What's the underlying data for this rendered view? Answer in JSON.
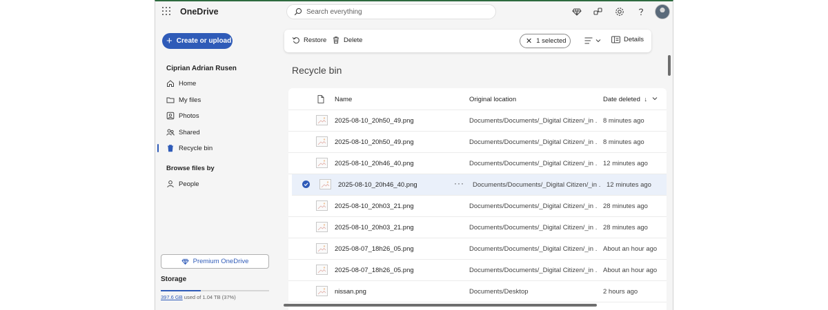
{
  "header": {
    "app_name": "OneDrive",
    "search_placeholder": "Search everything"
  },
  "sidebar": {
    "create_label": "Create or upload",
    "user_name": "Ciprian Adrian Rusen",
    "items": [
      {
        "label": "Home",
        "icon": "home-icon"
      },
      {
        "label": "My files",
        "icon": "folder-icon"
      },
      {
        "label": "Photos",
        "icon": "photos-icon"
      },
      {
        "label": "Shared",
        "icon": "shared-icon"
      },
      {
        "label": "Recycle bin",
        "icon": "recycle-bin-icon",
        "active": true
      }
    ],
    "browse_label": "Browse files by",
    "browse_items": [
      {
        "label": "People",
        "icon": "person-icon"
      }
    ],
    "premium_label": "Premium OneDrive",
    "storage_title": "Storage",
    "storage_used": "397.6 GB",
    "storage_rest": " used of 1.04 TB (37%)",
    "storage_fraction": 0.37
  },
  "toolbar": {
    "restore_label": "Restore",
    "delete_label": "Delete",
    "selected_label": "1 selected",
    "details_label": "Details"
  },
  "main": {
    "title": "Recycle bin",
    "columns": {
      "name": "Name",
      "location": "Original location",
      "date": "Date deleted"
    },
    "rows": [
      {
        "name": "2025-08-10_20h50_49.png",
        "location": "Documents/Documents/_Digital Citizen/_in ...",
        "date": "8 minutes ago",
        "selected": false
      },
      {
        "name": "2025-08-10_20h50_49.png",
        "location": "Documents/Documents/_Digital Citizen/_in ...",
        "date": "8 minutes ago",
        "selected": false
      },
      {
        "name": "2025-08-10_20h46_40.png",
        "location": "Documents/Documents/_Digital Citizen/_in ...",
        "date": "12 minutes ago",
        "selected": false
      },
      {
        "name": "2025-08-10_20h46_40.png",
        "location": "Documents/Documents/_Digital Citizen/_in ...",
        "date": "12 minutes ago",
        "selected": true
      },
      {
        "name": "2025-08-10_20h03_21.png",
        "location": "Documents/Documents/_Digital Citizen/_in ...",
        "date": "28 minutes ago",
        "selected": false
      },
      {
        "name": "2025-08-10_20h03_21.png",
        "location": "Documents/Documents/_Digital Citizen/_in ...",
        "date": "28 minutes ago",
        "selected": false
      },
      {
        "name": "2025-08-07_18h26_05.png",
        "location": "Documents/Documents/_Digital Citizen/_in ...",
        "date": "About an hour ago",
        "selected": false
      },
      {
        "name": "2025-08-07_18h26_05.png",
        "location": "Documents/Documents/_Digital Citizen/_in ...",
        "date": "About an hour ago",
        "selected": false
      },
      {
        "name": "nissan.png",
        "location": "Documents/Desktop",
        "date": "2 hours ago",
        "selected": false
      }
    ]
  },
  "colors": {
    "accent": "#2f5bb8",
    "selected_row": "#eaf0fa",
    "background": "#f5f5f5"
  }
}
